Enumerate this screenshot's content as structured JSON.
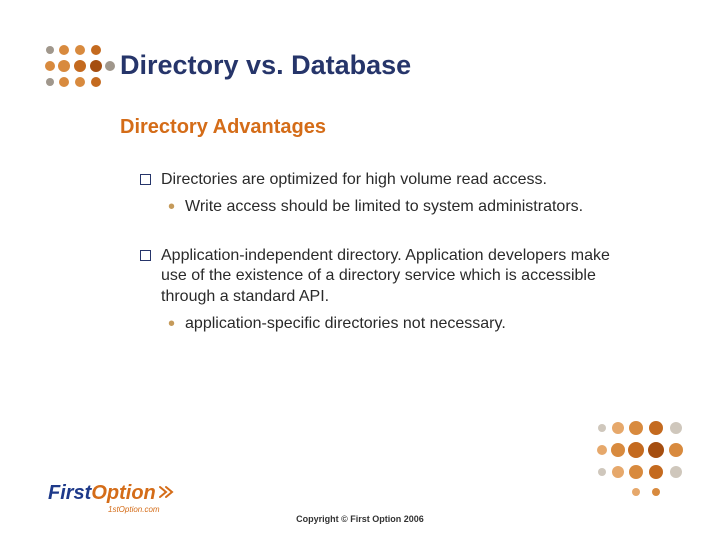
{
  "title": "Directory vs. Database",
  "subtitle": "Directory Advantages",
  "bullets": [
    {
      "text": "Directories are optimized for high volume read access.",
      "subs": [
        "Write access should be limited to system administrators."
      ]
    },
    {
      "text": "Application-independent directory.  Application developers make use of the existence of a directory service which is accessible through a standard API.",
      "subs": [
        "application-specific directories not necessary."
      ]
    }
  ],
  "logo": {
    "first": "First",
    "option": "Option",
    "sub": "1stOption.com"
  },
  "copyright": "Copyright © First Option 2006"
}
